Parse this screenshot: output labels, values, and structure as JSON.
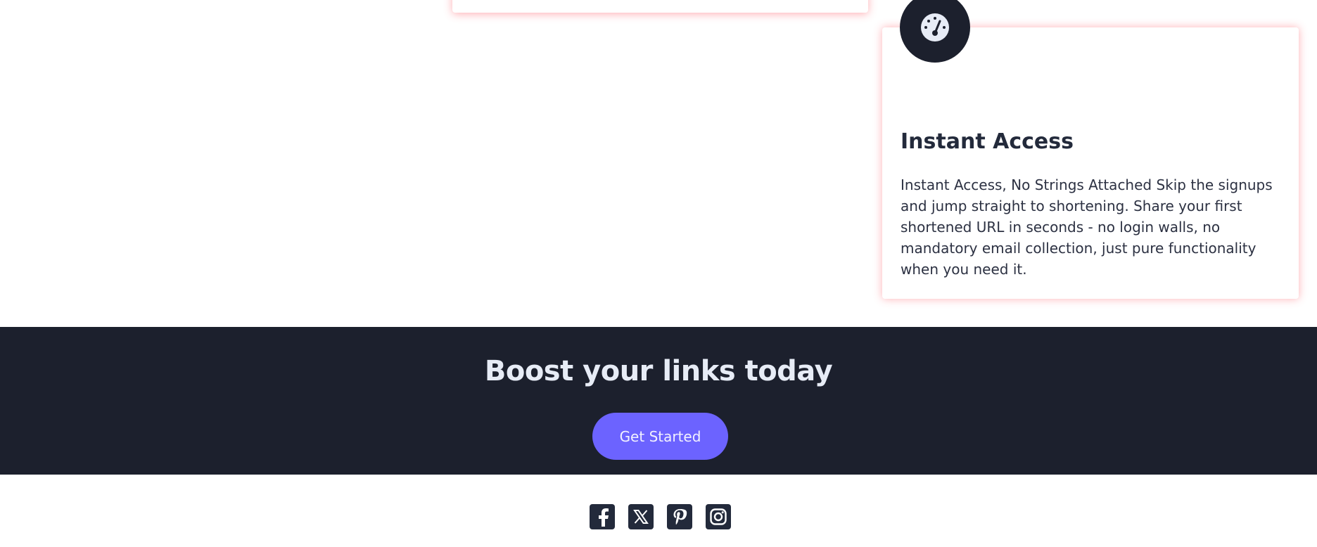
{
  "feature_card": {
    "icon": "speedometer-icon",
    "title": "Instant Access",
    "text": "Instant Access, No Strings Attached Skip the signups and jump straight to shortening. Share your first shortened URL in seconds - no login walls, no mandatory email collection, just pure functionality when you need it."
  },
  "cta": {
    "title": "Boost your links today",
    "button_label": "Get Started"
  },
  "footer": {
    "social_icons": [
      "facebook-icon",
      "x-icon",
      "pinterest-icon",
      "instagram-icon"
    ]
  },
  "colors": {
    "dark": "#1c202d",
    "accent": "#6c63ff",
    "card_glow": "#ff505a"
  }
}
